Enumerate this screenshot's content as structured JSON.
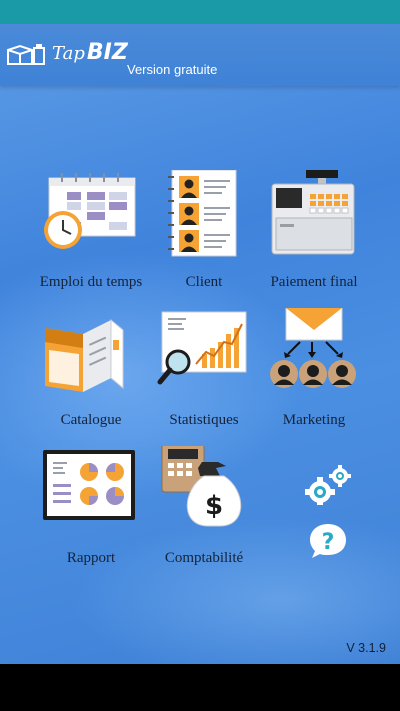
{
  "app": {
    "brand_tap": "Tap",
    "brand_biz": "BIZ",
    "edition": "Version gratuite",
    "version": "V 3.1.9"
  },
  "menu": [
    {
      "id": "schedule",
      "label": "Emploi du temps",
      "icon": "calendar-clock-icon"
    },
    {
      "id": "client",
      "label": "Client",
      "icon": "contacts-icon"
    },
    {
      "id": "payment",
      "label": "Paiement final",
      "icon": "cash-register-icon"
    },
    {
      "id": "catalog",
      "label": "Catalogue",
      "icon": "brochure-icon"
    },
    {
      "id": "statistics",
      "label": "Statistiques",
      "icon": "chart-magnifier-icon"
    },
    {
      "id": "marketing",
      "label": "Marketing",
      "icon": "mail-audience-icon"
    },
    {
      "id": "report",
      "label": "Rapport",
      "icon": "report-board-icon"
    },
    {
      "id": "accounting",
      "label": "Comptabilité",
      "icon": "calculator-moneybag-icon"
    }
  ],
  "actions": {
    "settings_icon": "gears-icon",
    "help_icon": "question-bubble-icon"
  },
  "colors": {
    "status_bar": "#1a9aa6",
    "background": "#4a8ad8",
    "accent_orange": "#f4a334",
    "label_text": "#14233a"
  }
}
